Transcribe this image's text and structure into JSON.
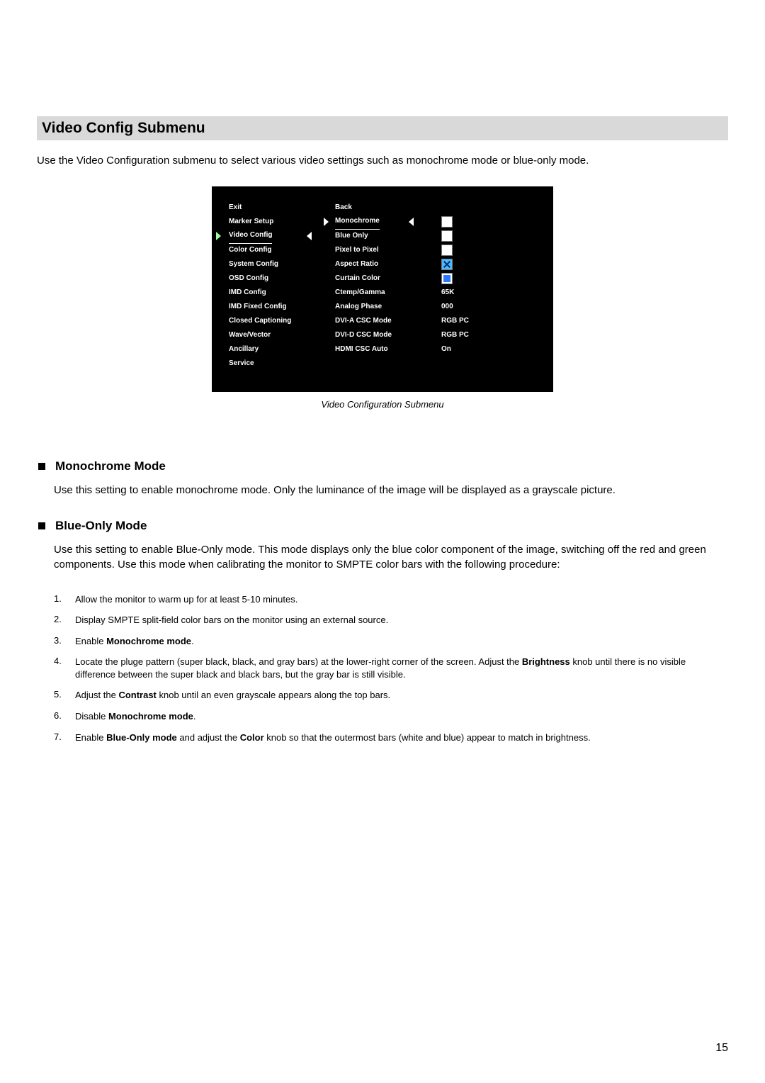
{
  "page_number": "15",
  "heading": "Video Config Submenu",
  "intro": "Use the Video Configuration submenu to select various video settings such as monochrome mode or blue-only mode.",
  "caption": "Video Configuration Submenu",
  "osd": {
    "left": [
      {
        "label": "Exit"
      },
      {
        "label": "Marker Setup"
      },
      {
        "label": "Video Config",
        "selected": true
      },
      {
        "label": "Color Config"
      },
      {
        "label": "System Config"
      },
      {
        "label": "OSD Config"
      },
      {
        "label": "IMD Config"
      },
      {
        "label": "IMD Fixed Config"
      },
      {
        "label": "Closed Captioning"
      },
      {
        "label": "Wave/Vector"
      },
      {
        "label": "Ancillary"
      },
      {
        "label": "Service"
      }
    ],
    "mid": [
      {
        "label": "Back"
      },
      {
        "label": "Monochrome",
        "selected": true,
        "value_type": "checkbox",
        "value_state": "empty"
      },
      {
        "label": "Blue Only",
        "value_type": "checkbox",
        "value_state": "empty"
      },
      {
        "label": "Pixel to Pixel",
        "value_type": "checkbox",
        "value_state": "empty"
      },
      {
        "label": "Aspect Ratio",
        "value_type": "checkbox",
        "value_state": "checked-x"
      },
      {
        "label": "Curtain Color",
        "value_type": "checkbox",
        "value_state": "filled-blue"
      },
      {
        "label": "Ctemp/Gamma",
        "value_type": "text",
        "value_text": "65K"
      },
      {
        "label": "Analog Phase",
        "value_type": "text",
        "value_text": "000"
      },
      {
        "label": "DVI-A CSC Mode",
        "value_type": "text",
        "value_text": "RGB PC"
      },
      {
        "label": "DVI-D CSC Mode",
        "value_type": "text",
        "value_text": "RGB PC"
      },
      {
        "label": "HDMI CSC Auto",
        "value_type": "text",
        "value_text": "On"
      }
    ]
  },
  "sections": [
    {
      "title": "Monochrome Mode",
      "body": "Use this setting to enable monochrome mode. Only the luminance of the image will be displayed as a grayscale picture."
    },
    {
      "title": "Blue-Only Mode",
      "body": "Use this setting to enable Blue-Only mode. This mode displays only the blue color component of the image, switching off the red and green components. Use this mode when calibrating the monitor to SMPTE color bars with the following procedure:"
    }
  ],
  "procedure": [
    {
      "n": "1.",
      "html": "Allow the monitor to warm up for at least 5-10 minutes."
    },
    {
      "n": "2.",
      "html": "Display SMPTE split-field color bars on the monitor using an external source."
    },
    {
      "n": "3.",
      "html": "Enable <b>Monochrome mode</b>."
    },
    {
      "n": "4.",
      "html": "Locate the pluge pattern (super black, black, and gray bars) at the lower-right corner of the screen. Adjust the <b>Brightness</b> knob until there is no visible difference between the super black and black bars, but the gray bar is still visible."
    },
    {
      "n": "5.",
      "html": "Adjust the <b>Contrast</b> knob until an even grayscale appears along the top bars."
    },
    {
      "n": "6.",
      "html": "Disable <b>Monochrome mode</b>."
    },
    {
      "n": "7.",
      "html": "Enable <b>Blue-Only mode</b> and adjust the <b>Color</b> knob so that the outermost bars (white and blue) appear to match in brightness."
    }
  ]
}
